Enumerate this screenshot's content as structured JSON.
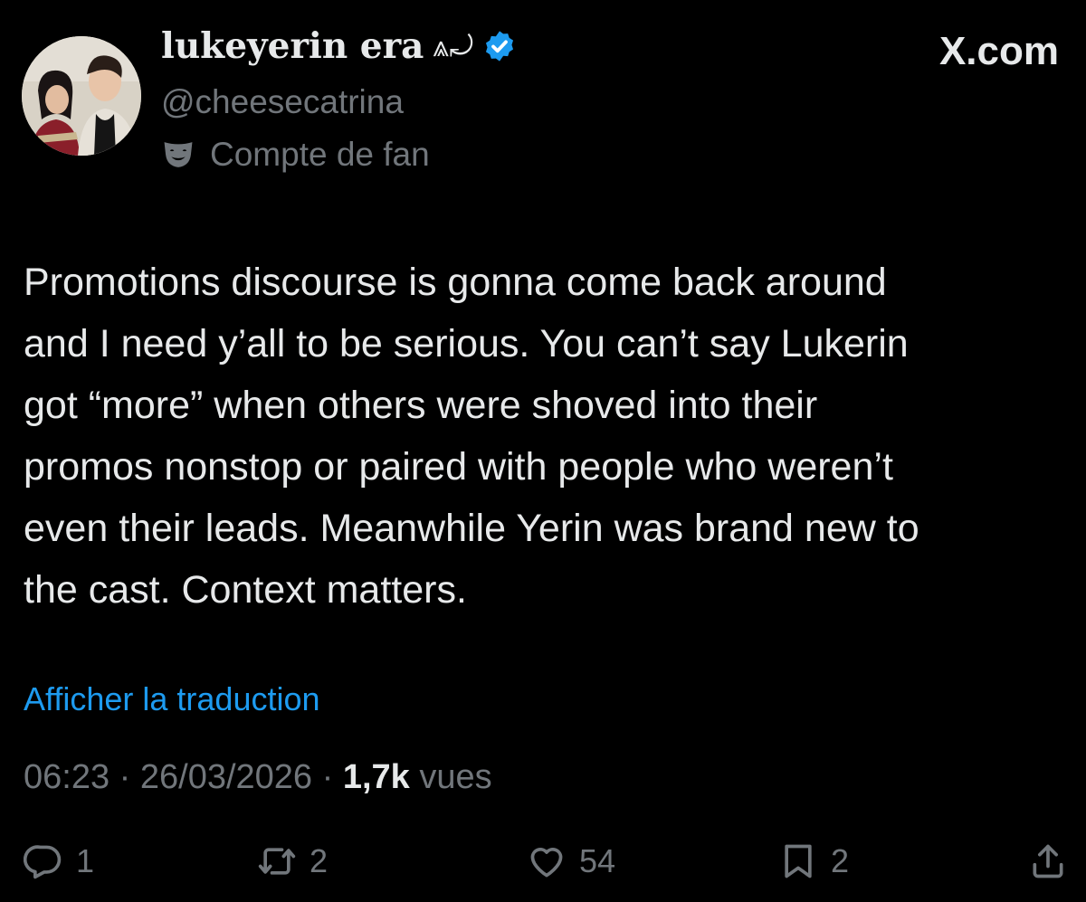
{
  "profile": {
    "display_name": "lukeyerin era",
    "name_emoji": "⩓⤾",
    "handle": "@cheesecatrina",
    "label": "Compte de fan",
    "verified_icon": "verified-badge-icon",
    "label_icon": "theater-mask-icon"
  },
  "brand": "X.com",
  "tweet": {
    "text": "Promotions discourse is gonna come back around\nand I need y’all to be serious. You can’t say Lukerin\ngot “more” when others were shoved into their\npromos nonstop or paired with people who weren’t\neven their leads. Meanwhile Yerin was brand new to\nthe cast. Context matters."
  },
  "translate_label": "Afficher la traduction",
  "meta": {
    "time": "06:23",
    "sep1": " · ",
    "date": "26/03/2026",
    "sep2": " · ",
    "views_count": "1,7k",
    "views_label": " vues"
  },
  "actions": {
    "reply_count": "1",
    "repost_count": "2",
    "like_count": "54",
    "bookmark_count": "2"
  },
  "colors": {
    "background": "#000000",
    "text": "#e7e9ea",
    "secondary": "#71767b",
    "link": "#1d9bf0",
    "verified": "#1d9bf0"
  }
}
